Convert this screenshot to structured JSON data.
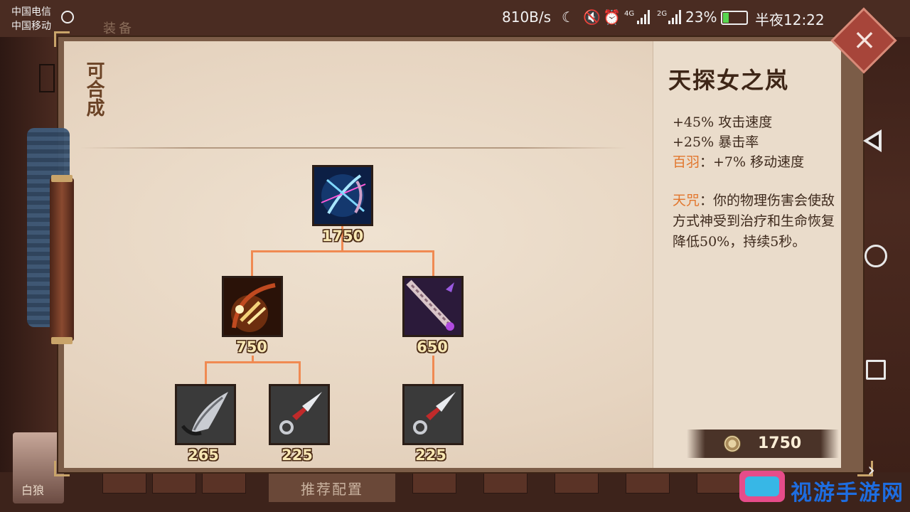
{
  "status_bar": {
    "carrier_1": "中国电信",
    "carrier_2": "中国移动",
    "net_speed": "810B/s",
    "network_1": "4G",
    "network_2": "2G",
    "battery": "23%",
    "time": "半夜12:22"
  },
  "background": {
    "header_title": "装备",
    "avatar_name": "白狼",
    "recommend_tab": "推荐配置"
  },
  "modal": {
    "tab_label": "可合成",
    "close_label": "×",
    "tree": {
      "root": {
        "price": "1750",
        "icon": "blue-bow-arrow-icon"
      },
      "mid_left": {
        "price": "750",
        "icon": "golden-bow-icon"
      },
      "mid_right": {
        "price": "650",
        "icon": "purple-spine-dagger-icon"
      },
      "leaf_1": {
        "price": "265",
        "icon": "silver-claw-blade-icon"
      },
      "leaf_2": {
        "price": "225",
        "icon": "kunai-icon"
      },
      "leaf_3": {
        "price": "225",
        "icon": "kunai-icon"
      }
    },
    "detail": {
      "name": "天探女之岚",
      "stat_1": "+45% 攻击速度",
      "stat_2": "+25% 暴击率",
      "stat_3_key": "百羽",
      "stat_3_value": "：+7% 移动速度",
      "passive_key": "天咒",
      "passive_text": "：你的物理伤害会使敌方式神受到治疗和生命恢复降低50%，持续5秒。",
      "total_price": "1750"
    },
    "colors": {
      "accent": "#e2762d",
      "connector": "#f08a52",
      "parchment": "#ecdfcf"
    }
  },
  "watermark": {
    "text": "视游手游网"
  }
}
